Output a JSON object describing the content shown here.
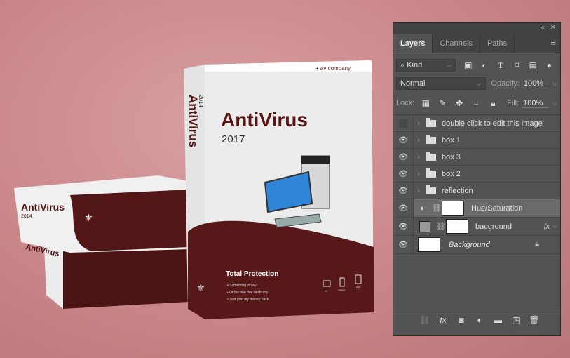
{
  "artwork": {
    "brand": "+ av company",
    "title": "AntiVirus",
    "year": "2017",
    "side_title": "AntiVirus",
    "side_year": "2014",
    "tagline": "Total Protection",
    "bullets": [
      "Something virusy",
      "Or the one that destructy",
      "Just give my money back"
    ],
    "platforms": [
      "PC",
      "Android",
      "iPad"
    ],
    "small_box_title": "AntiVirus",
    "small_box_year": "2014",
    "side_brand": "av company"
  },
  "panel": {
    "tabs": [
      {
        "label": "Layers"
      },
      {
        "label": "Channels"
      },
      {
        "label": "Paths"
      }
    ],
    "filter_kind": "Kind",
    "blend_mode": "Normal",
    "opacity_label": "Opacity:",
    "opacity": "100%",
    "lock_label": "Lock:",
    "fill_label": "Fill:",
    "fill": "100%",
    "layers": [
      {
        "name": "double click to edit this image",
        "visible": false,
        "type": "group"
      },
      {
        "name": "box 1",
        "visible": true,
        "type": "group"
      },
      {
        "name": "box 3",
        "visible": true,
        "type": "group"
      },
      {
        "name": "box 2",
        "visible": true,
        "type": "group"
      },
      {
        "name": "reflection",
        "visible": true,
        "type": "group"
      },
      {
        "name": "Hue/Saturation",
        "visible": true,
        "type": "adjustment",
        "selected": true
      },
      {
        "name": "bacground",
        "visible": true,
        "type": "fill",
        "fx": "fx"
      },
      {
        "name": "Background",
        "visible": true,
        "type": "background",
        "locked": true
      }
    ]
  },
  "colors": {
    "box_maroon": "#5a1a1a",
    "panel_bg": "#535353",
    "canvas_bg": "#c98689"
  }
}
